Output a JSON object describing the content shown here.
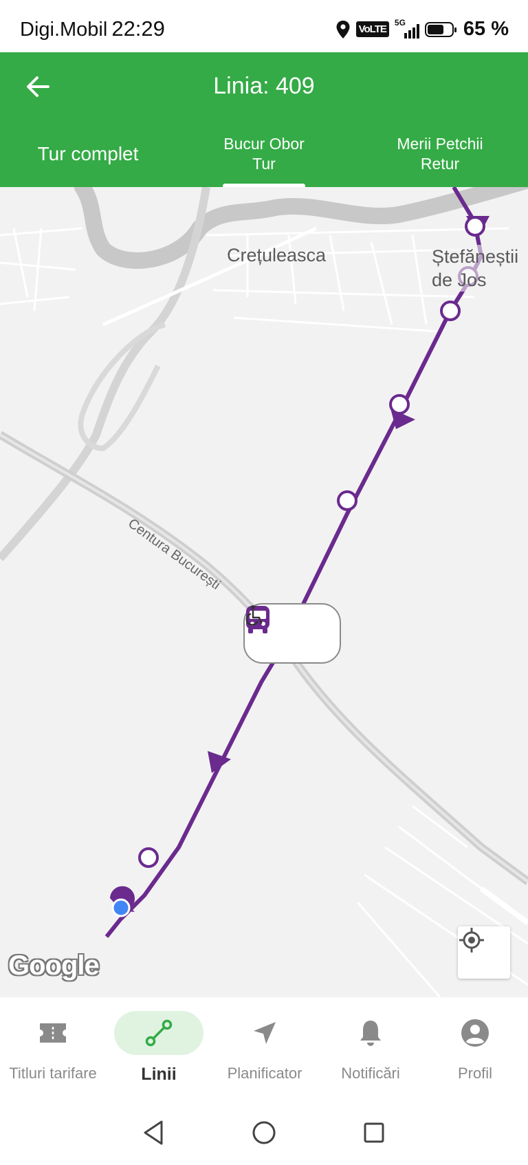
{
  "status_bar": {
    "carrier": "Digi.Mobil",
    "time": "22:29",
    "network": "5G",
    "volte": "VoLTE",
    "battery_percent_text": "65 %",
    "battery_level": 0.65
  },
  "header": {
    "title": "Linia: 409",
    "tabs": [
      {
        "label": "Tur complet",
        "selected": false
      },
      {
        "line1": "Bucur Obor",
        "line2": "Tur",
        "selected": true
      },
      {
        "line1": "Merii Petchii",
        "line2": "Retur",
        "selected": false
      }
    ]
  },
  "map": {
    "places": [
      "Crețuleasca",
      "Ștefăneștii de Jos"
    ],
    "road_label": "Centura București",
    "route_color": "#6a2a8e",
    "attribution": "Google",
    "vehicle_icon": "bus-icon",
    "accessibility_icon": "wheelchair-icon",
    "locate_icon": "crosshair-icon"
  },
  "bottom_nav": {
    "items": [
      {
        "label": "Titluri tarifare",
        "icon": "ticket-icon"
      },
      {
        "label": "Linii",
        "icon": "route-icon",
        "active": true
      },
      {
        "label": "Planificator",
        "icon": "navigation-arrow-icon"
      },
      {
        "label": "Notificări",
        "icon": "bell-icon"
      },
      {
        "label": "Profil",
        "icon": "user-icon"
      }
    ]
  },
  "colors": {
    "accent_green": "#34ab46",
    "active_nav_bg": "#dff3e0",
    "route_purple": "#6a2a8e"
  }
}
